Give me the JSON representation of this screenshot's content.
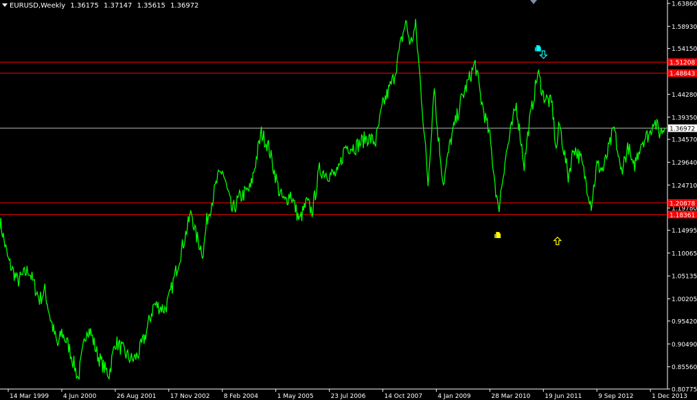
{
  "header": {
    "symbol": "EURUSD,Weekly",
    "open": "1.36175",
    "high": "1.37147",
    "low": "1.35615",
    "close": "1.36972"
  },
  "colors": {
    "background": "#000000",
    "price": "#00ff00",
    "axis": "#ffffff",
    "hline": "#ff0000",
    "current_line": "#bfbfbf",
    "arrow_up": "#ffff00",
    "arrow_down": "#00ffff"
  },
  "chart_data": {
    "type": "line",
    "ylim": [
      0.8077,
      1.6386
    ],
    "x_range": [
      "1999-01-04",
      "2014-03-31"
    ],
    "y_ticks": [
      "1.63860",
      "1.58930",
      "1.54150",
      "1.44280",
      "1.39350",
      "1.34570",
      "1.29640",
      "1.24710",
      "1.19780",
      "1.14995",
      "1.10065",
      "1.05135",
      "1.00205",
      "0.95420",
      "0.90490",
      "0.85560",
      "0.80775"
    ],
    "x_ticks": [
      {
        "label": "14 Mar 1999",
        "date": "1999-03-14"
      },
      {
        "label": "4 Jun 2000",
        "date": "2000-06-04"
      },
      {
        "label": "26 Aug 2001",
        "date": "2001-08-26"
      },
      {
        "label": "17 Nov 2002",
        "date": "2002-11-17"
      },
      {
        "label": "8 Feb 2004",
        "date": "2004-02-08"
      },
      {
        "label": "1 May 2005",
        "date": "2005-05-01"
      },
      {
        "label": "23 Jul 2006",
        "date": "2006-07-23"
      },
      {
        "label": "14 Oct 2007",
        "date": "2007-10-14"
      },
      {
        "label": "4 Jan 2009",
        "date": "2009-01-04"
      },
      {
        "label": "28 Mar 2010",
        "date": "2010-03-28"
      },
      {
        "label": "19 Jun 2011",
        "date": "2011-06-19"
      },
      {
        "label": "9 Sep 2012",
        "date": "2012-09-09"
      },
      {
        "label": "1 Dec 2013",
        "date": "2013-12-01"
      }
    ],
    "price_points": [
      [
        "1999-01-04",
        1.17
      ],
      [
        "1999-03-14",
        1.085
      ],
      [
        "1999-06-01",
        1.04
      ],
      [
        "1999-09-01",
        1.065
      ],
      [
        "1999-12-01",
        1.0
      ],
      [
        "2000-01-15",
        1.02
      ],
      [
        "2000-03-01",
        0.96
      ],
      [
        "2000-05-01",
        0.9
      ],
      [
        "2000-06-04",
        0.93
      ],
      [
        "2000-08-01",
        0.9
      ],
      [
        "2000-10-20",
        0.83
      ],
      [
        "2000-12-31",
        0.94
      ],
      [
        "2001-02-01",
        0.93
      ],
      [
        "2001-04-01",
        0.88
      ],
      [
        "2001-06-01",
        0.85
      ],
      [
        "2001-07-06",
        0.84
      ],
      [
        "2001-08-26",
        0.91
      ],
      [
        "2001-10-01",
        0.9
      ],
      [
        "2001-12-01",
        0.88
      ],
      [
        "2002-01-15",
        0.87
      ],
      [
        "2002-03-01",
        0.88
      ],
      [
        "2002-05-01",
        0.92
      ],
      [
        "2002-07-15",
        0.99
      ],
      [
        "2002-10-15",
        0.98
      ],
      [
        "2002-11-17",
        1.0
      ],
      [
        "2003-01-15",
        1.06
      ],
      [
        "2003-05-26",
        1.19
      ],
      [
        "2003-07-01",
        1.14
      ],
      [
        "2003-09-01",
        1.1
      ],
      [
        "2003-10-01",
        1.17
      ],
      [
        "2003-12-31",
        1.26
      ],
      [
        "2004-02-08",
        1.28
      ],
      [
        "2004-05-01",
        1.19
      ],
      [
        "2004-07-01",
        1.22
      ],
      [
        "2004-10-01",
        1.24
      ],
      [
        "2004-12-31",
        1.36
      ],
      [
        "2005-03-01",
        1.33
      ],
      [
        "2005-06-01",
        1.23
      ],
      [
        "2005-07-15",
        1.21
      ],
      [
        "2005-09-01",
        1.23
      ],
      [
        "2005-11-15",
        1.17
      ],
      [
        "2006-01-15",
        1.21
      ],
      [
        "2006-03-01",
        1.19
      ],
      [
        "2006-05-01",
        1.28
      ],
      [
        "2006-07-23",
        1.27
      ],
      [
        "2006-10-01",
        1.27
      ],
      [
        "2006-12-01",
        1.33
      ],
      [
        "2007-03-01",
        1.33
      ],
      [
        "2007-06-01",
        1.35
      ],
      [
        "2007-08-15",
        1.34
      ],
      [
        "2007-10-14",
        1.42
      ],
      [
        "2007-12-01",
        1.45
      ],
      [
        "2008-01-15",
        1.48
      ],
      [
        "2008-04-22",
        1.6
      ],
      [
        "2008-06-01",
        1.55
      ],
      [
        "2008-07-15",
        1.59
      ],
      [
        "2008-09-01",
        1.44
      ],
      [
        "2008-10-27",
        1.25
      ],
      [
        "2008-12-18",
        1.47
      ],
      [
        "2009-01-04",
        1.39
      ],
      [
        "2009-03-04",
        1.25
      ],
      [
        "2009-05-01",
        1.34
      ],
      [
        "2009-08-01",
        1.43
      ],
      [
        "2009-11-25",
        1.51
      ],
      [
        "2010-01-15",
        1.43
      ],
      [
        "2010-03-28",
        1.35
      ],
      [
        "2010-06-07",
        1.19
      ],
      [
        "2010-08-01",
        1.3
      ],
      [
        "2010-11-04",
        1.42
      ],
      [
        "2011-01-10",
        1.29
      ],
      [
        "2011-02-15",
        1.37
      ],
      [
        "2011-05-04",
        1.49
      ],
      [
        "2011-06-19",
        1.44
      ],
      [
        "2011-09-01",
        1.42
      ],
      [
        "2011-10-04",
        1.32
      ],
      [
        "2011-11-01",
        1.38
      ],
      [
        "2012-01-13",
        1.265
      ],
      [
        "2012-03-01",
        1.33
      ],
      [
        "2012-05-01",
        1.3
      ],
      [
        "2012-07-24",
        1.205
      ],
      [
        "2012-09-09",
        1.29
      ],
      [
        "2012-11-01",
        1.28
      ],
      [
        "2013-02-01",
        1.37
      ],
      [
        "2013-03-27",
        1.275
      ],
      [
        "2013-06-01",
        1.33
      ],
      [
        "2013-07-09",
        1.28
      ],
      [
        "2013-09-15",
        1.34
      ],
      [
        "2013-12-01",
        1.36
      ],
      [
        "2013-12-27",
        1.39
      ],
      [
        "2014-02-15",
        1.36
      ],
      [
        "2014-03-31",
        1.37
      ]
    ],
    "hlines": [
      {
        "value": 1.512,
        "label": "1.51208"
      },
      {
        "value": 1.4884,
        "label": "1.48843"
      },
      {
        "value": 1.2087,
        "label": "1.20878"
      },
      {
        "value": 1.1836,
        "label": "1.18361"
      }
    ],
    "current": {
      "value": 1.36972,
      "label": "1.36972"
    },
    "markers": [
      {
        "type": "thumb-icon",
        "date": "2010-06-07",
        "value": 1.1395,
        "color": "#ffff00"
      },
      {
        "type": "up-arrow",
        "date": "2011-10-15",
        "value": 1.126,
        "color": "#ffff00"
      },
      {
        "type": "thumb-icon",
        "date": "2011-05-10",
        "value": 1.542,
        "color": "#00ffff"
      },
      {
        "type": "down-arrow",
        "date": "2011-06-20",
        "value": 1.529,
        "color": "#00ffff"
      }
    ]
  }
}
